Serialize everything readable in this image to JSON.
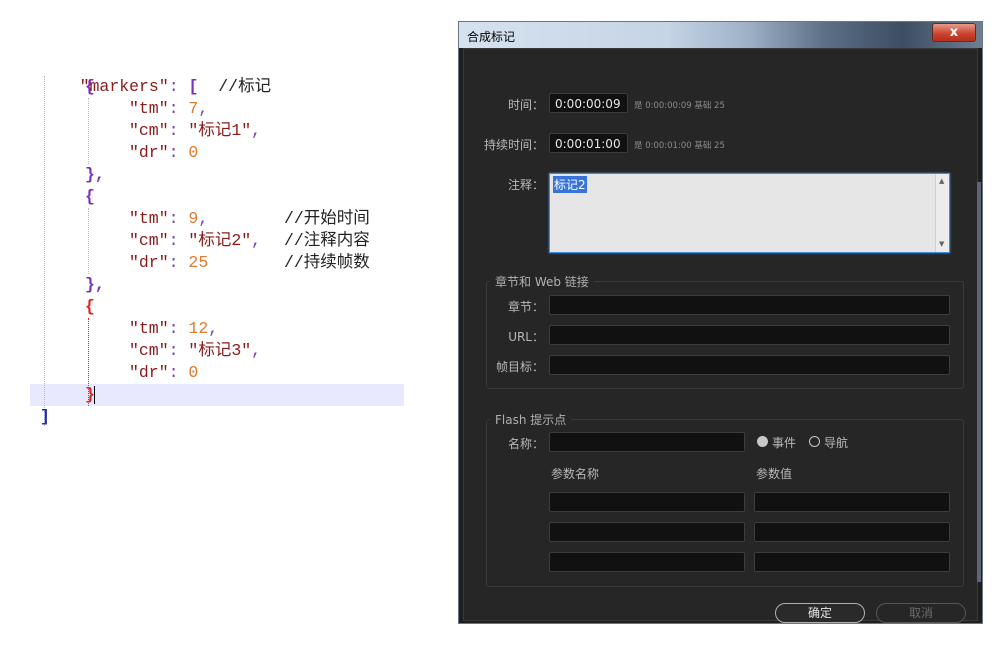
{
  "code": {
    "lines": [
      {
        "key": "\"markers\"",
        "colon": ": ",
        "bracket": "[",
        "comment": "//标记"
      },
      {
        "brace": "{"
      },
      {
        "key": "\"tm\"",
        "colon": ": ",
        "value": "7",
        "comma": ","
      },
      {
        "key": "\"cm\"",
        "colon": ": ",
        "value": "\"标记1\"",
        "comma": ","
      },
      {
        "key": "\"dr\"",
        "colon": ": ",
        "value": "0"
      },
      {
        "brace": "},"
      },
      {
        "brace": "{"
      },
      {
        "key": "\"tm\"",
        "colon": ": ",
        "value": "9",
        "comma": ",",
        "comment": "//开始时间"
      },
      {
        "key": "\"cm\"",
        "colon": ": ",
        "value": "\"标记2\"",
        "comma": ",",
        "comment": "//注释内容"
      },
      {
        "key": "\"dr\"",
        "colon": ": ",
        "value": "25",
        "comment": "//持续帧数"
      },
      {
        "brace": "},"
      },
      {
        "brace": "{"
      },
      {
        "key": "\"tm\"",
        "colon": ": ",
        "value": "12",
        "comma": ","
      },
      {
        "key": "\"cm\"",
        "colon": ": ",
        "value": "\"标记3\"",
        "comma": ","
      },
      {
        "key": "\"dr\"",
        "colon": ": ",
        "value": "0"
      },
      {
        "brace": "}"
      },
      {
        "brace": "]"
      }
    ]
  },
  "dialog": {
    "title": "合成标记",
    "close_glyph": "x",
    "time_label": "时间：",
    "time_value": "0:00:00:09",
    "time_hint": "是 0:00:00:09  基础 25",
    "duration_label": "持续时间：",
    "duration_value": "0:00:01:00",
    "duration_hint": "是 0:00:01:00  基础 25",
    "comment_label": "注释：",
    "comment_value": "标记2",
    "chapter_group": "章节和 Web 链接",
    "chapter_label": "章节：",
    "url_label": "URL：",
    "frame_target_label": "帧目标：",
    "flash_group": "Flash 提示点",
    "name_label": "名称：",
    "radio_event": "事件",
    "radio_nav": "导航",
    "param_name_header": "参数名称",
    "param_value_header": "参数值",
    "ok_label": "确定",
    "cancel_label": "取消"
  }
}
